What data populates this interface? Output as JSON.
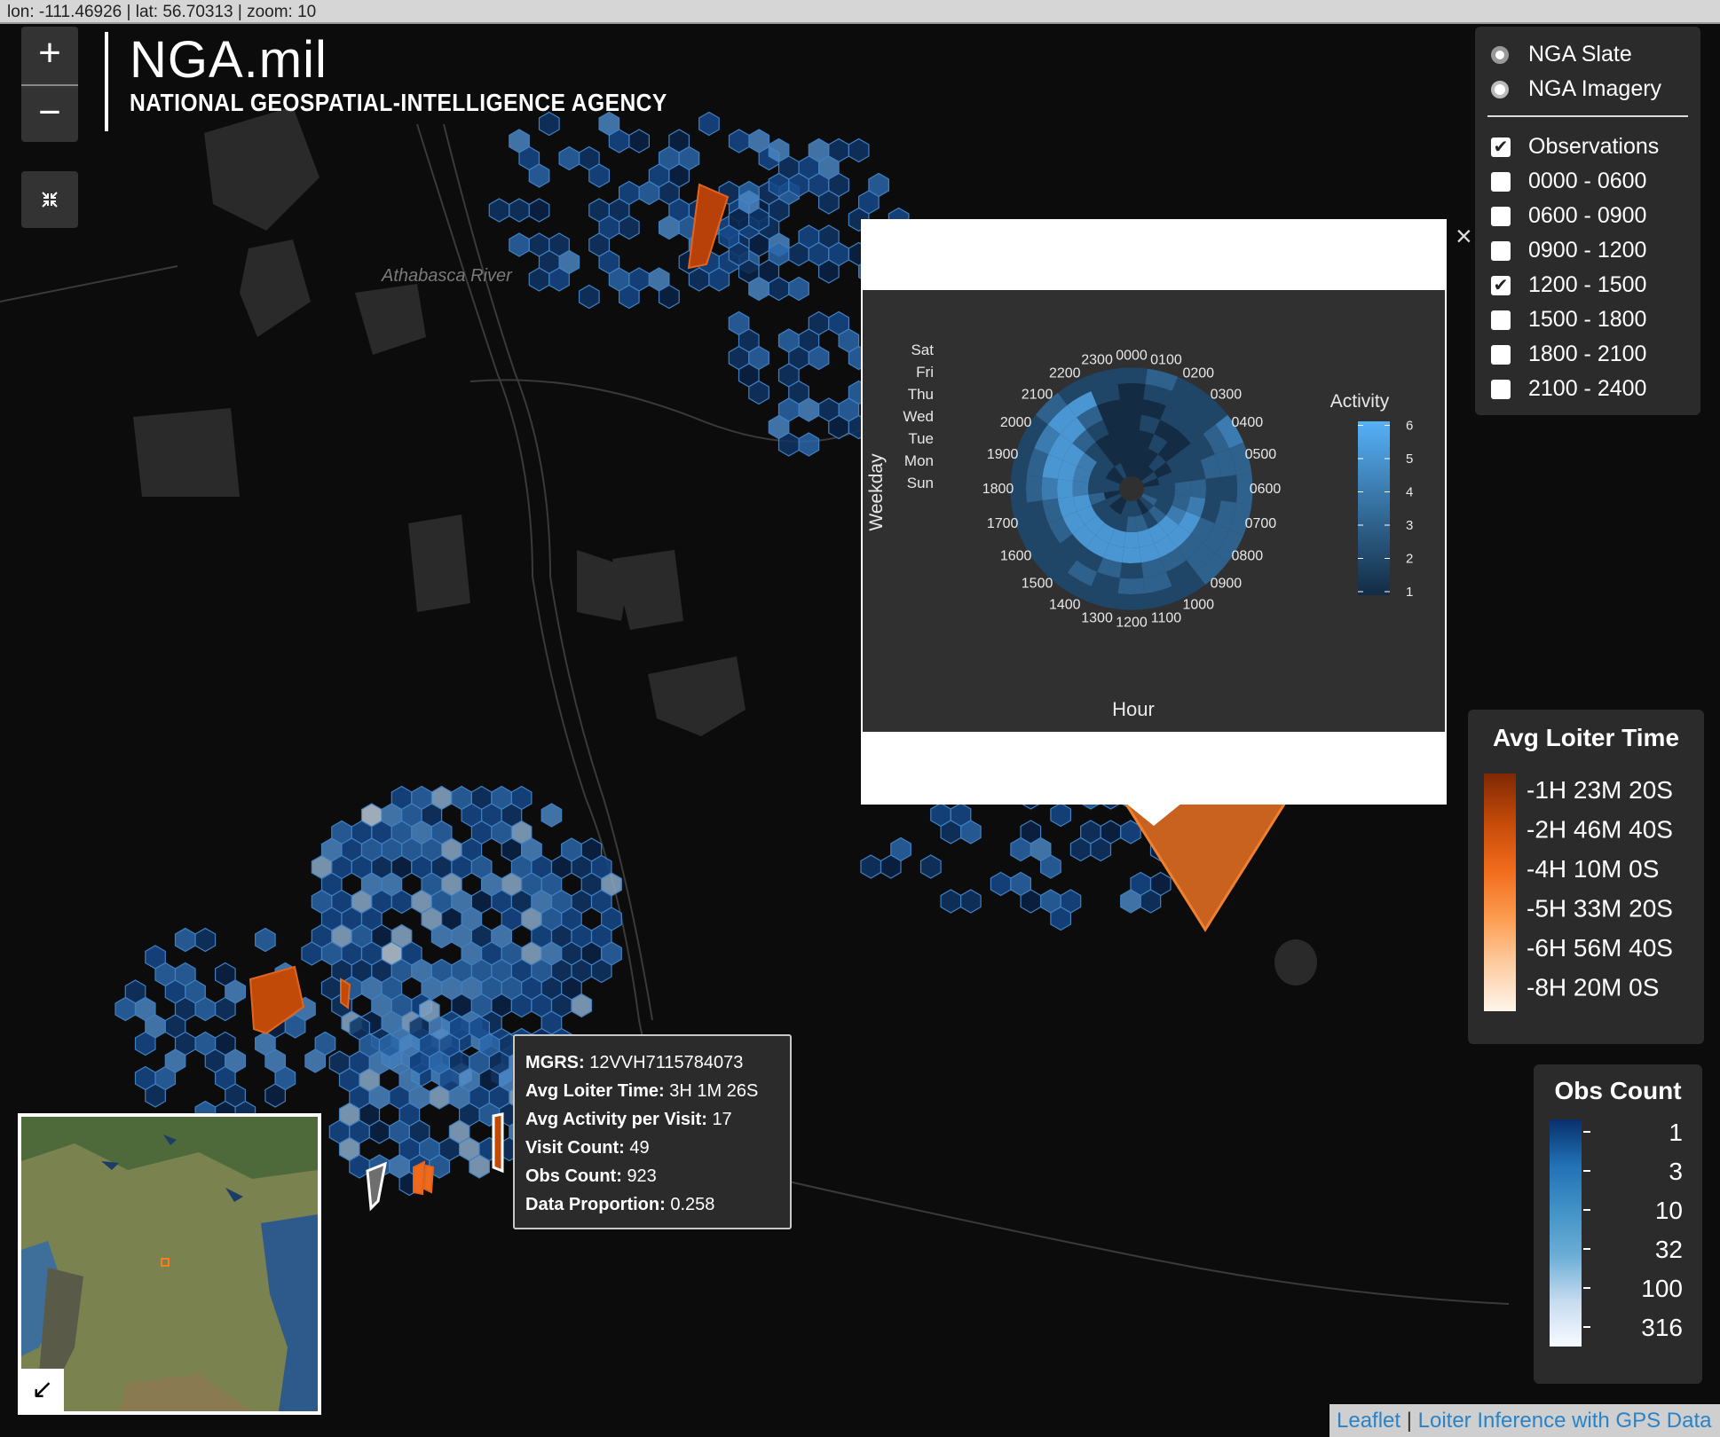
{
  "coords": "lon: -111.46926 | lat: 56.70313 | zoom: 10",
  "zoom": {
    "in": "+",
    "out": "−"
  },
  "fullscreen_icon": "collapse-icon",
  "logo": {
    "main": "NGA.mil",
    "sub": "NATIONAL GEOSPATIAL-INTELLIGENCE AGENCY"
  },
  "map_label": "Athabasca River",
  "layers": {
    "base": [
      {
        "label": "NGA Slate",
        "selected": true
      },
      {
        "label": "NGA Imagery",
        "selected": false
      }
    ],
    "overlays": [
      {
        "label": "Observations",
        "checked": true
      },
      {
        "label": "0000 - 0600",
        "checked": false
      },
      {
        "label": "0600 - 0900",
        "checked": false
      },
      {
        "label": "0900 - 1200",
        "checked": false
      },
      {
        "label": "1200 - 1500",
        "checked": true
      },
      {
        "label": "1500 - 1800",
        "checked": false
      },
      {
        "label": "1800 - 2100",
        "checked": false
      },
      {
        "label": "2100 - 2400",
        "checked": false
      }
    ]
  },
  "popup": {
    "close": "×",
    "chart_data": {
      "type": "heatmap",
      "subtype": "polar",
      "hours": [
        "0000",
        "0100",
        "0200",
        "0300",
        "0400",
        "0500",
        "0600",
        "0700",
        "0800",
        "0900",
        "1000",
        "1100",
        "1200",
        "1300",
        "1400",
        "1500",
        "1600",
        "1700",
        "1800",
        "1900",
        "2000",
        "2100",
        "2200",
        "2300"
      ],
      "weekdays": [
        "Sun",
        "Mon",
        "Tue",
        "Wed",
        "Thu",
        "Fri",
        "Sat"
      ],
      "weekday_labels_top_down": [
        "Sat",
        "Fri",
        "Thu",
        "Wed",
        "Tue",
        "Mon",
        "Sun"
      ],
      "xlabel": "Hour",
      "ylabel": "Weekday",
      "legend_title": "Activity",
      "scale": [
        1,
        2,
        3,
        4,
        5,
        6
      ],
      "colors": {
        "low": "#132b43",
        "high": "#56b1f7"
      },
      "values": [
        [
          1,
          1,
          1,
          1,
          2,
          1,
          2,
          2,
          3,
          2,
          1,
          2,
          2,
          2,
          1,
          1,
          2,
          1,
          2,
          2,
          1,
          1,
          2,
          1
        ],
        [
          1,
          1,
          1,
          2,
          1,
          2,
          2,
          2,
          2,
          3,
          2,
          3,
          3,
          2,
          2,
          2,
          2,
          3,
          2,
          2,
          2,
          2,
          1,
          1
        ],
        [
          1,
          1,
          2,
          1,
          2,
          2,
          3,
          3,
          4,
          5,
          5,
          5,
          5,
          5,
          5,
          5,
          5,
          5,
          4,
          4,
          4,
          2,
          1,
          1
        ],
        [
          1,
          2,
          1,
          1,
          2,
          2,
          3,
          4,
          5,
          5,
          5,
          5,
          5,
          5,
          5,
          5,
          5,
          5,
          5,
          5,
          5,
          3,
          2,
          1
        ],
        [
          1,
          1,
          2,
          2,
          2,
          3,
          2,
          2,
          3,
          3,
          3,
          3,
          2,
          3,
          2,
          2,
          3,
          3,
          4,
          5,
          5,
          5,
          3,
          1
        ],
        [
          1,
          2,
          2,
          2,
          3,
          3,
          2,
          3,
          3,
          3,
          2,
          3,
          3,
          2,
          3,
          2,
          2,
          2,
          3,
          3,
          4,
          5,
          5,
          2
        ],
        [
          2,
          3,
          2,
          2,
          4,
          3,
          3,
          3,
          3,
          3,
          2,
          2,
          2,
          2,
          2,
          2,
          2,
          2,
          2,
          2,
          2,
          3,
          2,
          2
        ]
      ]
    }
  },
  "loiter_legend": {
    "title": "Avg Loiter Time",
    "labels": [
      "1H 23M 20S",
      "2H 46M 40S",
      "4H 10M 0S",
      "5H 33M 20S",
      "6H 56M 40S",
      "8H 20M 0S"
    ],
    "colors": [
      "#7f2704",
      "#c24a08",
      "#f06a1a",
      "#fd9a4d",
      "#fdcca0",
      "#fff5eb"
    ]
  },
  "obs_legend": {
    "title": "Obs Count",
    "labels": [
      "1",
      "3",
      "10",
      "32",
      "100",
      "316"
    ],
    "colors": [
      "#08306b",
      "#2171b5",
      "#4292c6",
      "#6baed6",
      "#c6dbef",
      "#f7fbff"
    ]
  },
  "tooltip": [
    {
      "key": "MGRS:",
      "value": "12VVH7115784073"
    },
    {
      "key": "Avg Loiter Time:",
      "value": "3H 1M 26S"
    },
    {
      "key": "Avg Activity per Visit:",
      "value": "17"
    },
    {
      "key": "Visit Count:",
      "value": "49"
    },
    {
      "key": "Obs Count:",
      "value": "923"
    },
    {
      "key": "Data Proportion:",
      "value": "0.258"
    }
  ],
  "minimap_toggle": "↙",
  "attribution": {
    "leaflet": "Leaflet",
    "sep": "|",
    "source": "Loiter Inference with GPS Data"
  }
}
